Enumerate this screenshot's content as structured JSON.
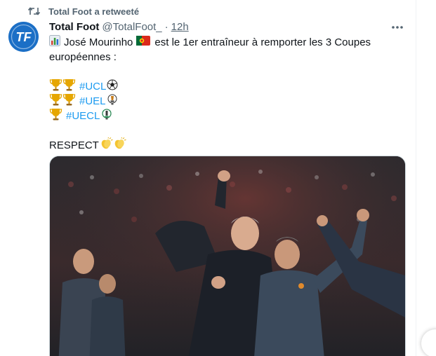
{
  "retweet": {
    "label": "Total Foot a retweeté",
    "icon": "retweet-icon"
  },
  "tweet": {
    "avatar_logo_text": "TF",
    "author_name": "Total Foot",
    "handle": "@TotalFoot_",
    "separator": "·",
    "time": "12h",
    "line1_prefix": "José Mourinho",
    "line1_suffix": "est le 1er entraîneur à remporter les 3 Coupes",
    "line2": "européennes :",
    "ucl_tag": "#UCL",
    "uel_tag": "#UEL",
    "uecl_tag": "#UECL",
    "respect": "RESPECT"
  },
  "colors": {
    "link": "#1d9bf0",
    "muted": "#536471",
    "avatar": "#1b6fc6",
    "trophy": "#e6a600"
  }
}
